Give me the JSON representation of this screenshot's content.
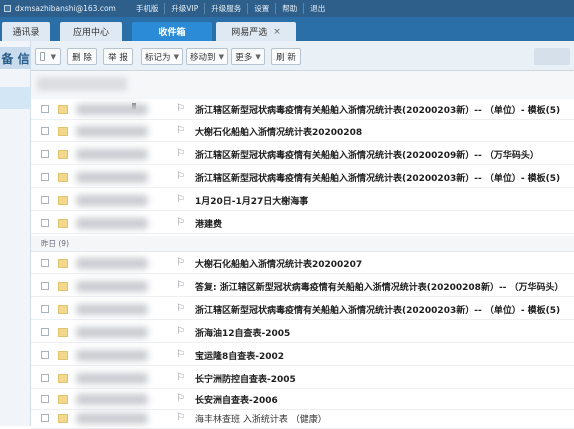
{
  "topbar": {
    "email": "dxmsazhibanshi@163.com",
    "links": [
      "手机版",
      "升级VIP",
      "升级服务",
      "设置",
      "帮助",
      "退出"
    ]
  },
  "tabs": [
    {
      "label": "通讯录",
      "active": false
    },
    {
      "label": "应用中心",
      "active": false
    },
    {
      "label": "收件箱",
      "active": true
    },
    {
      "label": "网易严选",
      "active": false
    }
  ],
  "sidebar": {
    "title": "备 信"
  },
  "toolbar": {
    "delete": "删 除",
    "report": "举 报",
    "mark_as": "标记为",
    "move_to": "移动到",
    "more": "更多",
    "refresh": "刷 新"
  },
  "groups": {
    "yesterday": "昨日 (9)"
  },
  "messages_today": [
    {
      "subject": "浙江辖区新型冠状病毒疫情有关船舶入浙情况统计表(20200203新）-- （单位）- 模板(5)"
    },
    {
      "subject": "大榭石化船舶入浙情况统计表20200208"
    },
    {
      "subject": "浙江辖区新型冠状病毒疫情有关船舶入浙情况统计表(20200209新）-- （万华码头）"
    },
    {
      "subject": "浙江辖区新型冠状病毒疫情有关船舶入浙情况统计表(20200203新）-- （单位）- 模板(5)"
    },
    {
      "subject": "1月20日-1月27日大榭海事"
    },
    {
      "subject": "港建费"
    }
  ],
  "messages_yesterday": [
    {
      "subject": "大榭石化船舶入浙情况统计表20200207"
    },
    {
      "subject": "答复: 浙江辖区新型冠状病毒疫情有关船舶入浙情况统计表(20200208新）-- （万华码头）"
    },
    {
      "subject": "浙江辖区新型冠状病毒疫情有关船舶入浙情况统计表(20200203新）-- （单位）- 模板(5)"
    },
    {
      "subject": "浙海油12自查表-2005"
    },
    {
      "subject": "宝运隆8自查表-2002"
    },
    {
      "subject": "长宁洲防控自查表-2005"
    },
    {
      "subject": "长安洲自查表-2006"
    },
    {
      "subject": "海丰林查班 入浙统计表 （健康）",
      "read": true
    }
  ]
}
